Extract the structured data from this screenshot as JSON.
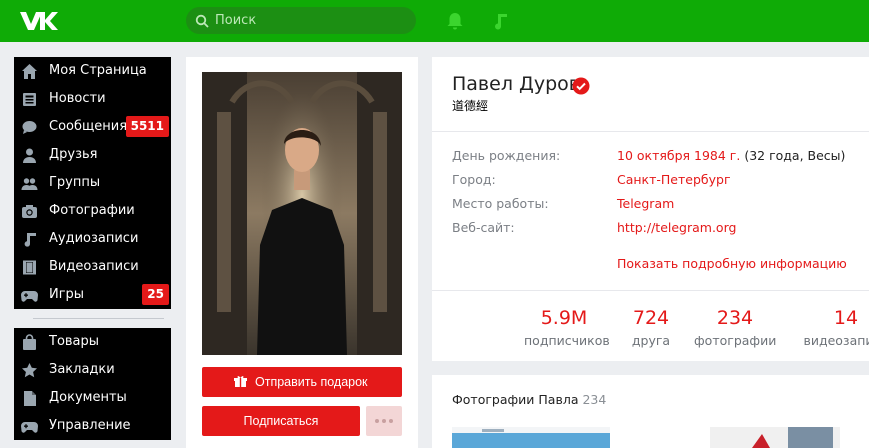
{
  "header": {
    "search_placeholder": "Поиск",
    "bg_color": "#0fab06",
    "icons": [
      "vk-logo-icon",
      "search-icon",
      "bell-icon",
      "music-note-icon"
    ]
  },
  "sidebar": {
    "main": [
      {
        "label": "Моя Страница",
        "icon": "home-icon"
      },
      {
        "label": "Новости",
        "icon": "news-icon"
      },
      {
        "label": "Сообщения",
        "icon": "chat-icon",
        "badge": "5511"
      },
      {
        "label": "Друзья",
        "icon": "user-icon"
      },
      {
        "label": "Группы",
        "icon": "group-icon"
      },
      {
        "label": "Фотографии",
        "icon": "camera-icon"
      },
      {
        "label": "Аудиозаписи",
        "icon": "music-icon"
      },
      {
        "label": "Видеозаписи",
        "icon": "film-icon"
      },
      {
        "label": "Игры",
        "icon": "gamepad-icon",
        "badge": "25"
      }
    ],
    "secondary": [
      {
        "label": "Товары",
        "icon": "bag-icon"
      },
      {
        "label": "Закладки",
        "icon": "star-icon"
      },
      {
        "label": "Документы",
        "icon": "document-icon"
      },
      {
        "label": "Управление",
        "icon": "gamepad-icon"
      }
    ]
  },
  "profile": {
    "name": "Павел Дуров",
    "status": "道德經",
    "gift_button": "Отправить подарок",
    "subscribe_button": "Подписаться",
    "info": [
      {
        "key": "День рождения:",
        "value": "10 октября 1984 г.",
        "extra": " (32 года, Весы)"
      },
      {
        "key": "Город:",
        "value": "Санкт-Петербург",
        "extra": ""
      },
      {
        "key": "Место работы:",
        "value": "Telegram",
        "extra": ""
      },
      {
        "key": "Веб-сайт:",
        "value": "http://telegram.org",
        "extra": ""
      }
    ],
    "show_more": "Показать подробную информацию",
    "counters": [
      {
        "num": "5.9M",
        "label": "подписчиков"
      },
      {
        "num": "724",
        "label": "друга"
      },
      {
        "num": "234",
        "label": "фотографии"
      },
      {
        "num": "14",
        "label": "видеозаписи"
      }
    ]
  },
  "photos": {
    "title": "Фотографии Павла",
    "count": "234"
  },
  "colors": {
    "accent": "#e41919",
    "menu_bg": "#000000",
    "page_bg": "#eceef1"
  }
}
